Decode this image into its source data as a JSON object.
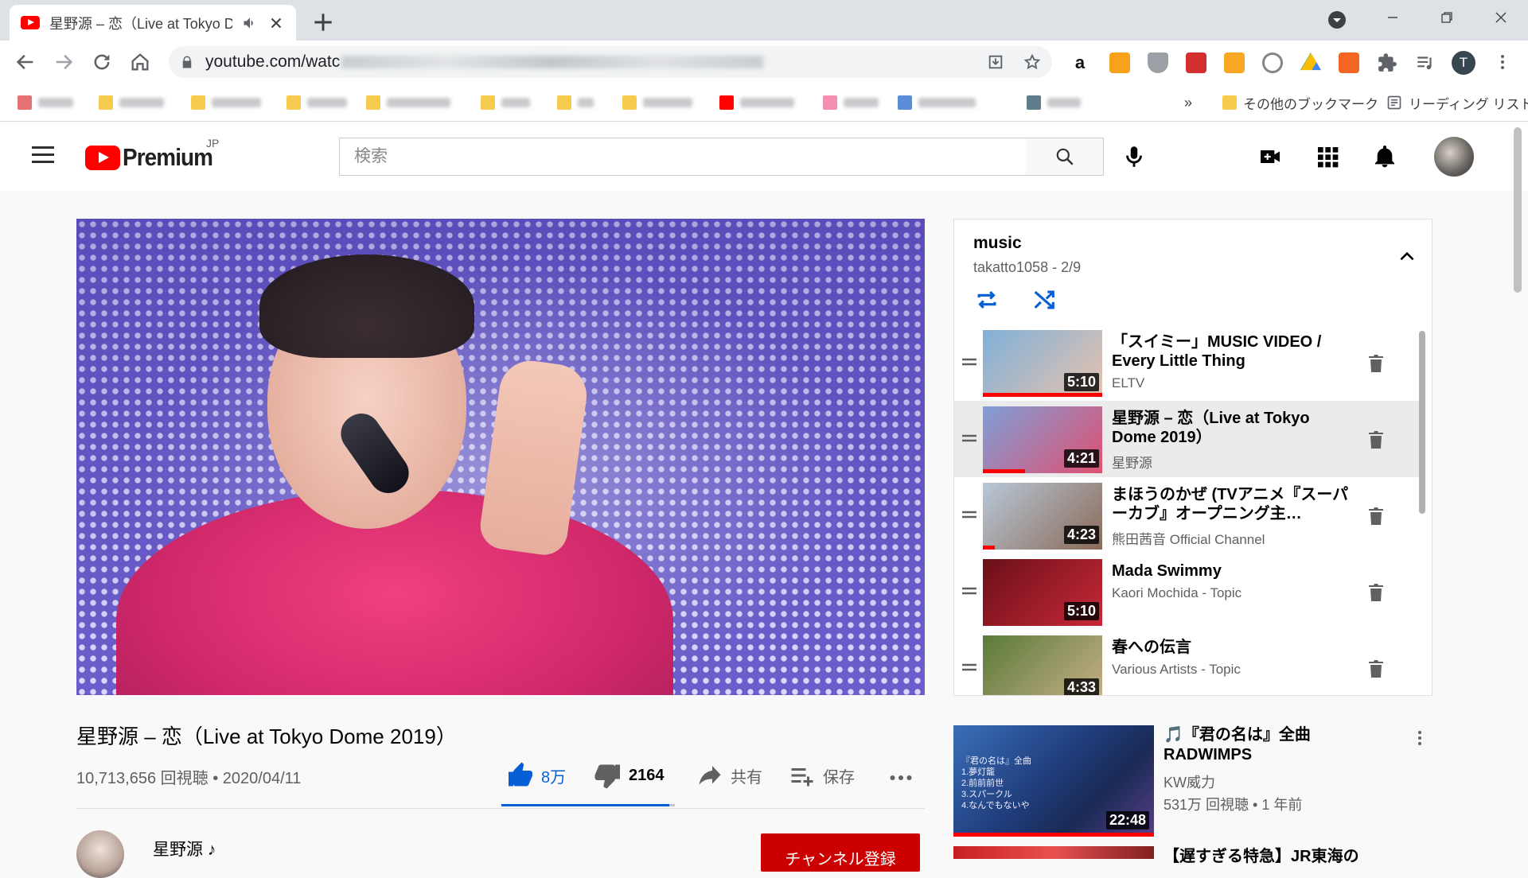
{
  "browser": {
    "tab_title": "星野源 – 恋（Live at Tokyo D",
    "url": "youtube.com/watc",
    "bookmarks_more": "その他のブックマーク",
    "reading_list": "リーディング リスト",
    "profile_initial": "T"
  },
  "header": {
    "logo_word": "Premium",
    "logo_region": "JP",
    "search_placeholder": "検索"
  },
  "video": {
    "title": "星野源 – 恋（Live at Tokyo Dome 2019）",
    "meta": "10,713,656 回視聴 • 2020/04/11",
    "likes": "8万",
    "dislikes": "2164",
    "share_label": "共有",
    "save_label": "保存",
    "like_ratio": 0.97,
    "channel_name": "星野源 ♪",
    "subscribe_label": "チャンネル登録"
  },
  "playlist": {
    "title": "music",
    "subtitle": "takatto1058 - 2/9",
    "items": [
      {
        "title": "「スイミー」MUSIC VIDEO / Every Little Thing",
        "channel": "ELTV",
        "duration": "5:10",
        "watched": 1.0,
        "active": false,
        "thumb": [
          "#7fb0d8",
          "#e7c3ae"
        ]
      },
      {
        "title": "星野源 – 恋（Live at Tokyo Dome 2019）",
        "channel": "星野源",
        "duration": "4:21",
        "watched": 0.35,
        "active": true,
        "thumb": [
          "#7f9fd8",
          "#e05070"
        ]
      },
      {
        "title": "まほうのかぜ (TVアニメ『スーパーカブ』オープニング主…",
        "channel": "熊田茜音 Official Channel",
        "duration": "4:23",
        "watched": 0.1,
        "active": false,
        "thumb": [
          "#b8c8d8",
          "#8a6a58"
        ]
      },
      {
        "title": "Mada Swimmy",
        "channel": "Kaori Mochida - Topic",
        "duration": "5:10",
        "watched": 0,
        "active": false,
        "thumb": [
          "#6a1018",
          "#c82838"
        ]
      },
      {
        "title": "春への伝言",
        "channel": "Various Artists - Topic",
        "duration": "4:33",
        "watched": 0,
        "active": false,
        "thumb": [
          "#5a7a3a",
          "#c8b088"
        ]
      }
    ]
  },
  "recommendation": {
    "title": "🎵『君の名は』全曲 RADWIMPS",
    "channel": "KW威力",
    "meta": "531万 回視聴 • 1 年前",
    "duration": "22:48",
    "thumb_lines": [
      "『君の名は』全曲",
      "1.夢灯籠",
      "2.前前前世",
      "3.スパークル",
      "4.なんでもないや"
    ],
    "next_title": "【遅すぎる特急】JR東海の"
  }
}
